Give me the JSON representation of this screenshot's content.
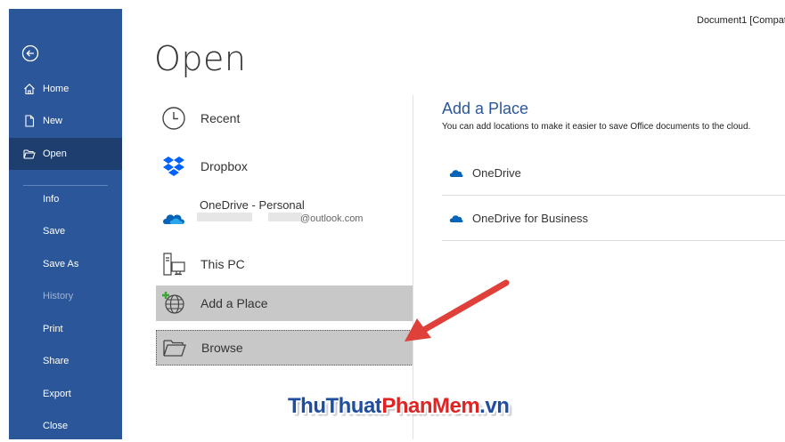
{
  "window": {
    "title": "Document1 [Compat"
  },
  "sidebar": {
    "items": [
      {
        "label": "Home",
        "icon": "home-icon"
      },
      {
        "label": "New",
        "icon": "new-document-icon"
      },
      {
        "label": "Open",
        "icon": "open-folder-icon",
        "active": true
      },
      {
        "label": "Info"
      },
      {
        "label": "Save"
      },
      {
        "label": "Save As"
      },
      {
        "label": "History",
        "disabled": true
      },
      {
        "label": "Print"
      },
      {
        "label": "Share"
      },
      {
        "label": "Export"
      },
      {
        "label": "Close"
      }
    ]
  },
  "page": {
    "title": "Open"
  },
  "locations": [
    {
      "label": "Recent",
      "icon": "clock-icon"
    },
    {
      "label": "Dropbox",
      "icon": "dropbox-icon"
    },
    {
      "label": "OneDrive - Personal",
      "sub": "@outlook.com",
      "icon": "onedrive-icon"
    },
    {
      "label": "This PC",
      "icon": "pc-icon"
    },
    {
      "label": "Add a Place",
      "icon": "globe-add-icon",
      "selected": true
    },
    {
      "label": "Browse",
      "icon": "folder-icon"
    }
  ],
  "add_place": {
    "title": "Add a Place",
    "description": "You can add locations to make it easier to save Office documents to the cloud.",
    "options": [
      {
        "label": "OneDrive"
      },
      {
        "label": "OneDrive for Business"
      }
    ]
  },
  "watermark": {
    "part1": "ThuThuat",
    "part2": "PhanMem",
    "part3": ".vn"
  },
  "colors": {
    "sidebar": "#2b579a",
    "active": "#1d3e6e",
    "accent": "#2b579a",
    "arrow": "#e0403a"
  }
}
